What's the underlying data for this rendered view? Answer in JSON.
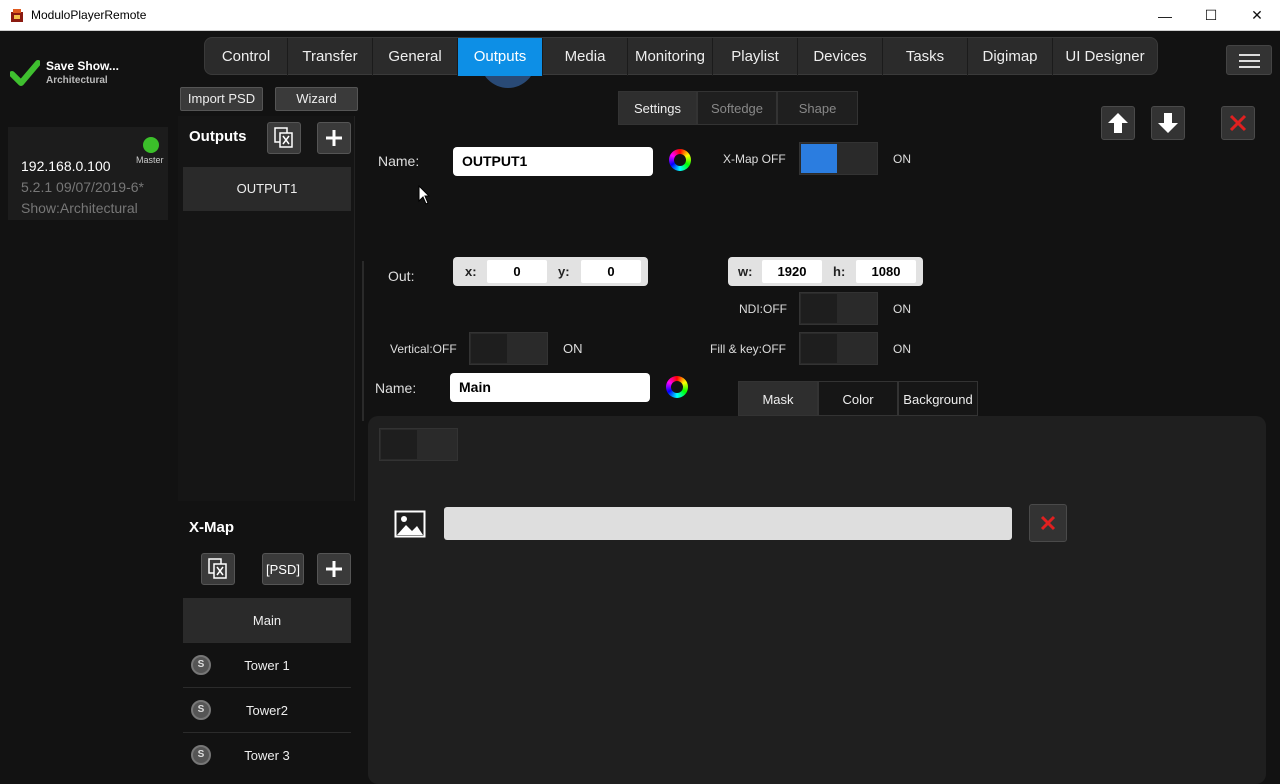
{
  "window": {
    "title": "ModuloPlayerRemote",
    "minimize": "—",
    "maximize": "☐",
    "close": "✕"
  },
  "status": {
    "save_label": "Save Show...",
    "show_name": "Architectural"
  },
  "server": {
    "ip": "192.168.0.100",
    "version": "5.2.1 09/07/2019-6*",
    "show": "Show:Architectural",
    "role": "Master",
    "status_color": "#3bbf2a"
  },
  "nav": {
    "tabs": [
      "Control",
      "Transfer",
      "General",
      "Outputs",
      "Media",
      "Monitoring",
      "Playlist",
      "Devices",
      "Tasks",
      "Digimap",
      "UI Designer"
    ],
    "active": "Outputs",
    "accent": "#0d8fe6"
  },
  "outputs_panel": {
    "import_psd": "Import PSD",
    "wizard": "Wizard",
    "title": "Outputs",
    "items": [
      "OUTPUT1"
    ]
  },
  "xmap_panel": {
    "title": "X-Map",
    "psd_label": "[PSD]",
    "items": [
      {
        "name": "Main",
        "selected": true,
        "badge": ""
      },
      {
        "name": "Tower 1",
        "selected": false,
        "badge": "S"
      },
      {
        "name": "Tower2",
        "selected": false,
        "badge": "S"
      },
      {
        "name": "Tower 3",
        "selected": false,
        "badge": "S"
      }
    ]
  },
  "settings": {
    "subtabs": [
      "Settings",
      "Softedge",
      "Shape"
    ],
    "active_subtab": "Settings",
    "name_label": "Name:",
    "name_value": "OUTPUT1",
    "xmap_off_label": "X-Map OFF",
    "xmap_on_label": "ON",
    "xmap_enabled": true,
    "out_label": "Out:",
    "x_label": "x:",
    "x_value": "0",
    "y_label": "y:",
    "y_value": "0",
    "w_label": "w:",
    "w_value": "1920",
    "h_label": "h:",
    "h_value": "1080",
    "ndi_label": "NDI:OFF",
    "ndi_on": "ON",
    "vertical_label": "Vertical:OFF",
    "vertical_on": "ON",
    "fillkey_label": "Fill & key:OFF",
    "fillkey_on": "ON"
  },
  "xmap_settings": {
    "name_label": "Name:",
    "name_value": "Main",
    "tabs": [
      "Mask",
      "Color",
      "Background"
    ],
    "active_tab": "Mask",
    "file_path": ""
  }
}
